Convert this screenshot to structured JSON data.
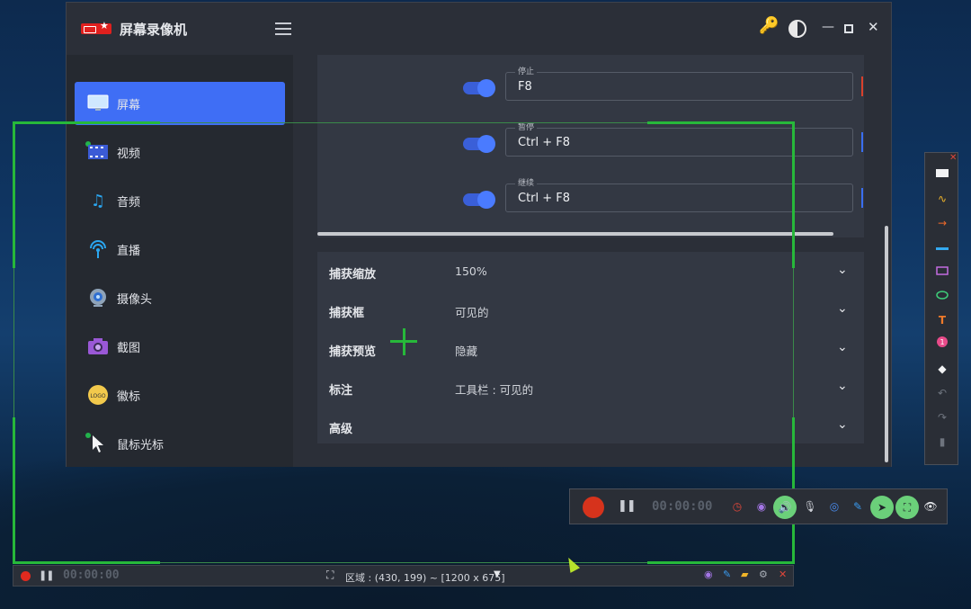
{
  "app": {
    "title": "屏幕录像机"
  },
  "sidebar": {
    "items": [
      {
        "label": "屏幕",
        "icon": "monitor-icon",
        "active": true,
        "dot": false
      },
      {
        "label": "视频",
        "icon": "film-icon",
        "active": false,
        "dot": true
      },
      {
        "label": "音频",
        "icon": "music-note-icon",
        "active": false,
        "dot": false
      },
      {
        "label": "直播",
        "icon": "broadcast-icon",
        "active": false,
        "dot": false
      },
      {
        "label": "摄像头",
        "icon": "webcam-icon",
        "active": false,
        "dot": false
      },
      {
        "label": "截图",
        "icon": "camera-icon",
        "active": false,
        "dot": false
      },
      {
        "label": "徽标",
        "icon": "logo-badge-icon",
        "active": false,
        "dot": false
      },
      {
        "label": "鼠标光标",
        "icon": "mouse-cursor-icon",
        "active": false,
        "dot": true
      }
    ]
  },
  "hotkeys": [
    {
      "legend": "停止",
      "value": "F8",
      "enabled": true,
      "edge_color": "#d9402b"
    },
    {
      "legend": "暂停",
      "value": "Ctrl + F8",
      "enabled": true,
      "edge_color": "#3a6ef0"
    },
    {
      "legend": "继续",
      "value": "Ctrl + F8",
      "enabled": true,
      "edge_color": "#3a6ef0"
    }
  ],
  "settings": [
    {
      "label": "捕获缩放",
      "value": "150%"
    },
    {
      "label": "捕获框",
      "value": "可见的"
    },
    {
      "label": "捕获预览",
      "value": "隐藏"
    },
    {
      "label": "标注",
      "value": "工具栏 : 可见的"
    },
    {
      "label": "高级",
      "value": ""
    }
  ],
  "capture_bar": {
    "time": "00:00:00",
    "region": "区域 : (430, 199) ~ [1200 x 675]"
  },
  "recorder": {
    "time": "00:00:00"
  },
  "colors": {
    "accent": "#3f6ef5",
    "frame": "#27b83a",
    "record": "#e02a1f",
    "key": "#f4b41a"
  }
}
